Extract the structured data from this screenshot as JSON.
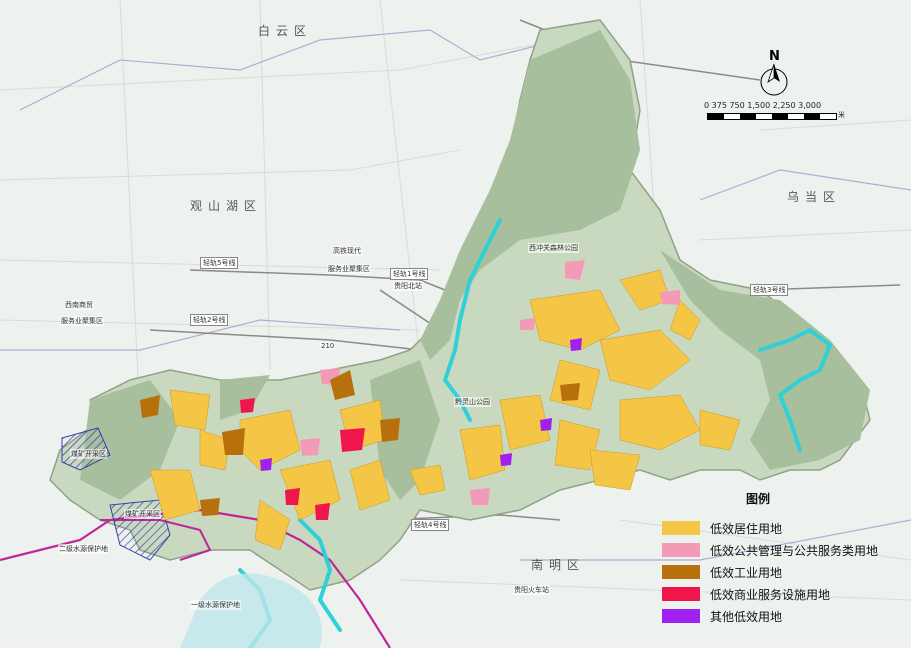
{
  "districts": {
    "baiyun": "白云区",
    "guanshanhu": "观山湖区",
    "wudang": "乌当区",
    "nanming": "南明区"
  },
  "place_labels": {
    "xijiang_park": "西冲关森林公园",
    "qianling_park": "黔灵山公园",
    "gaotie": "高铁现代",
    "gaotie2": "服务业聚集区",
    "gaotie_north": "贵阳北站",
    "xinan": "西南商贸",
    "xinan2": "服务业聚集区",
    "coal_a": "煤矿开采区",
    "coal_b": "煤矿开采区",
    "water_1": "二级水源保护地",
    "water_2": "一级水源保护地",
    "road_tag": "210",
    "south_station": "贵阳火车站"
  },
  "rail_lines": {
    "line1": "轻轨1号线",
    "line2": "轻轨2号线",
    "line3": "轻轨3号线",
    "line4": "轻轨4号线",
    "line5": "轻轨5号线"
  },
  "compass": {
    "north_letter": "N"
  },
  "scale": {
    "ticks": "0   375 750      1,500    2,250    3,000",
    "unit": "米"
  },
  "legend": {
    "title": "图例",
    "items": [
      {
        "label": "低效居住用地",
        "color": "#f5c646"
      },
      {
        "label": "低效公共管理与公共服务类用地",
        "color": "#f49ab6"
      },
      {
        "label": "低效工业用地",
        "color": "#b8700c"
      },
      {
        "label": "低效商业服务设施用地",
        "color": "#f0164c"
      },
      {
        "label": "其他低效用地",
        "color": "#a020f0"
      }
    ]
  },
  "colors": {
    "background": "#eef2ee",
    "study_area": "#c9d9c0",
    "forest": "#9cb592",
    "river": "#2fd0d8",
    "boundary": "#c0269a"
  }
}
